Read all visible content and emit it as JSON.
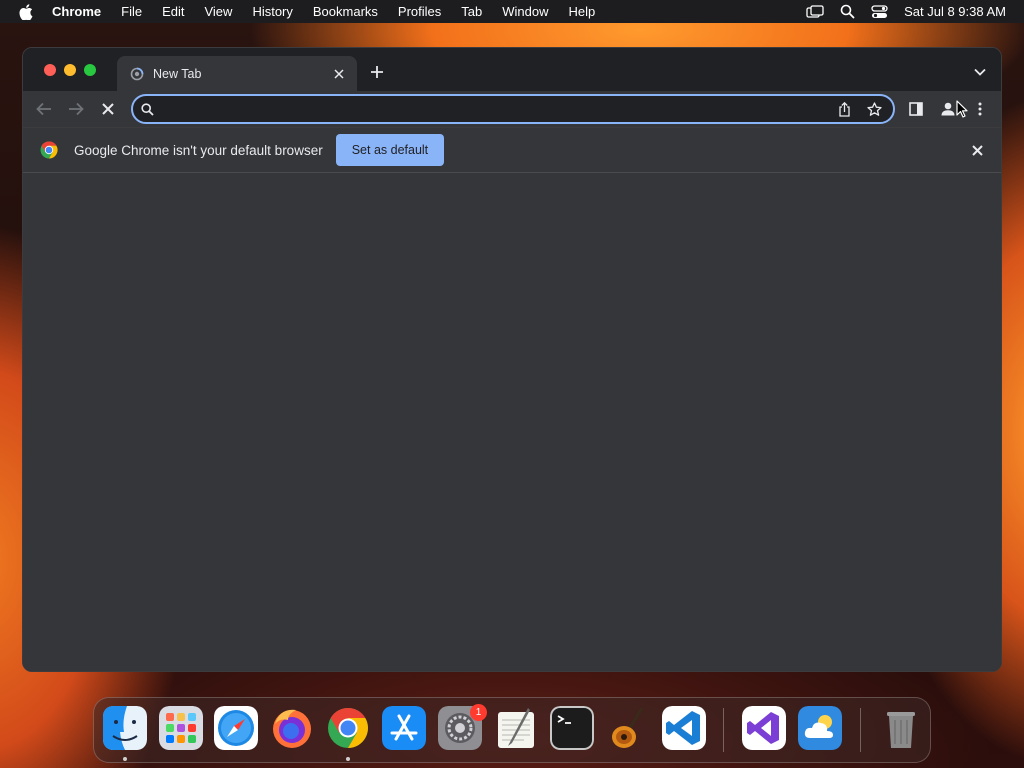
{
  "menubar": {
    "app_name": "Chrome",
    "items": [
      "File",
      "Edit",
      "View",
      "History",
      "Bookmarks",
      "Profiles",
      "Tab",
      "Window",
      "Help"
    ],
    "clock": "Sat Jul 8  9:38 AM",
    "status_icons": [
      "screen-mirroring-icon",
      "spotlight-search-icon",
      "control-center-icon"
    ]
  },
  "window": {
    "tab": {
      "title": "New Tab",
      "loading": true
    },
    "omnibox": {
      "value": "",
      "placeholder": ""
    },
    "infobar": {
      "message": "Google Chrome isn't your default browser",
      "button_label": "Set as default"
    }
  },
  "dock": {
    "apps": [
      {
        "name": "Finder",
        "running": true
      },
      {
        "name": "Launchpad",
        "running": false
      },
      {
        "name": "Safari",
        "running": false
      },
      {
        "name": "Firefox",
        "running": false
      },
      {
        "name": "Google Chrome",
        "running": true
      },
      {
        "name": "App Store",
        "running": false
      },
      {
        "name": "System Settings",
        "running": false,
        "badge": "1"
      },
      {
        "name": "TextEdit",
        "running": false
      },
      {
        "name": "Terminal",
        "running": false
      },
      {
        "name": "GarageBand",
        "running": false
      },
      {
        "name": "Visual Studio Code",
        "running": false
      },
      {
        "name": "Visual Studio",
        "running": false
      },
      {
        "name": "Weather",
        "running": false
      },
      {
        "name": "Trash",
        "running": false
      }
    ]
  },
  "colors": {
    "accent": "#8ab4f8",
    "window_bg": "#202124",
    "toolbar_bg": "#35363a",
    "badge": "#ff3b30"
  }
}
